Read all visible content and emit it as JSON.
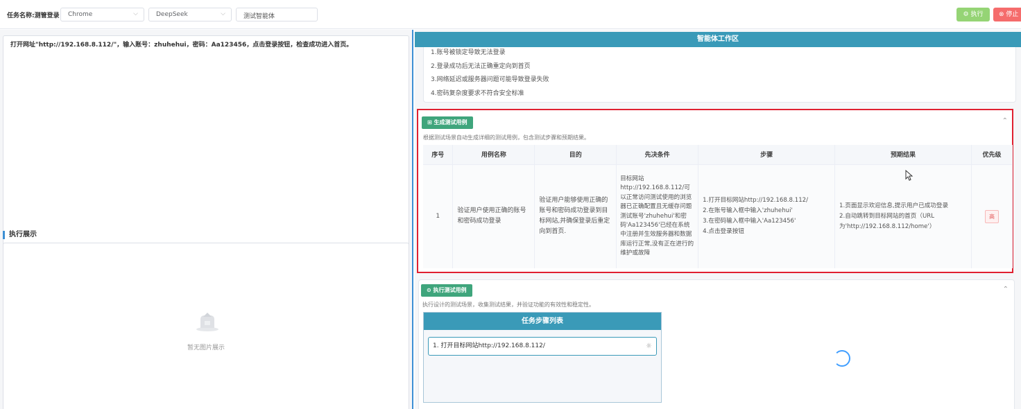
{
  "topbar": {
    "task_label": "任务名称:测管登录",
    "browser_select": "Chrome",
    "model_select": "DeepSeek",
    "agent_input": "测试智能体",
    "run_button": "执行",
    "stop_button": "停止"
  },
  "left": {
    "prompt_text": "打开网址\"http://192.168.8.112/\"，输入账号：zhuhehui，密码：Aa123456，点击登录按钮，检查成功进入首页。",
    "exec_title": "执行展示",
    "empty_text": "暂无图片展示"
  },
  "right": {
    "workarea_title": "智能体工作区",
    "risks": [
      "1.账号被锁定导致无法登录",
      "2.登录成功后无法正确重定向到首页",
      "3.网络延迟或服务器问题可能导致登录失败",
      "4.密码复杂度要求不符合安全标准"
    ],
    "gen_card": {
      "button": "生成测试用例",
      "desc": "根据测试场景自动生成详细的测试用例，包含测试步骤和预期结果。",
      "headers": [
        "序号",
        "用例名称",
        "目的",
        "先决条件",
        "步骤",
        "预期结果",
        "优先级"
      ],
      "row": {
        "index": "1",
        "name": "验证用户使用正确的账号和密码成功登录",
        "purpose": "验证用户能够使用正确的账号和密码成功登录到目标网站,并确保登录后重定向到首页.",
        "precondition": "目标网站http://192.168.8.112/可以正常访问测试使用的浏览器已正确配置且无缓存问题测试账号'zhuhehui'和密码'Aa123456'已经在系统中注册并生效服务器和数据库运行正常,没有正在进行的维护或故障",
        "steps": [
          "1.打开目标网站http://192.168.8.112/",
          "2.在账号输入框中输入'zhuhehui'",
          "3.在密码输入框中输入'Aa123456'",
          "4.点击登录按钮"
        ],
        "expected": [
          "1.页面显示欢迎信息,提示用户已成功登录",
          "2.自动跳转到目标网站的首页（URL为'http://192.168.8.112/home'）"
        ],
        "priority": "高"
      }
    },
    "exec_card": {
      "button": "执行测试用例",
      "desc": "执行设计的测试场景，收集测试结果，并验证功能的有效性和稳定性。",
      "steps_title": "任务步骤列表",
      "step_1": "1. 打开目标网站http://192.168.8.112/"
    }
  },
  "colors": {
    "accent": "#3a9ab8",
    "highlight_border": "#e02030",
    "green": "#3fa57c"
  }
}
